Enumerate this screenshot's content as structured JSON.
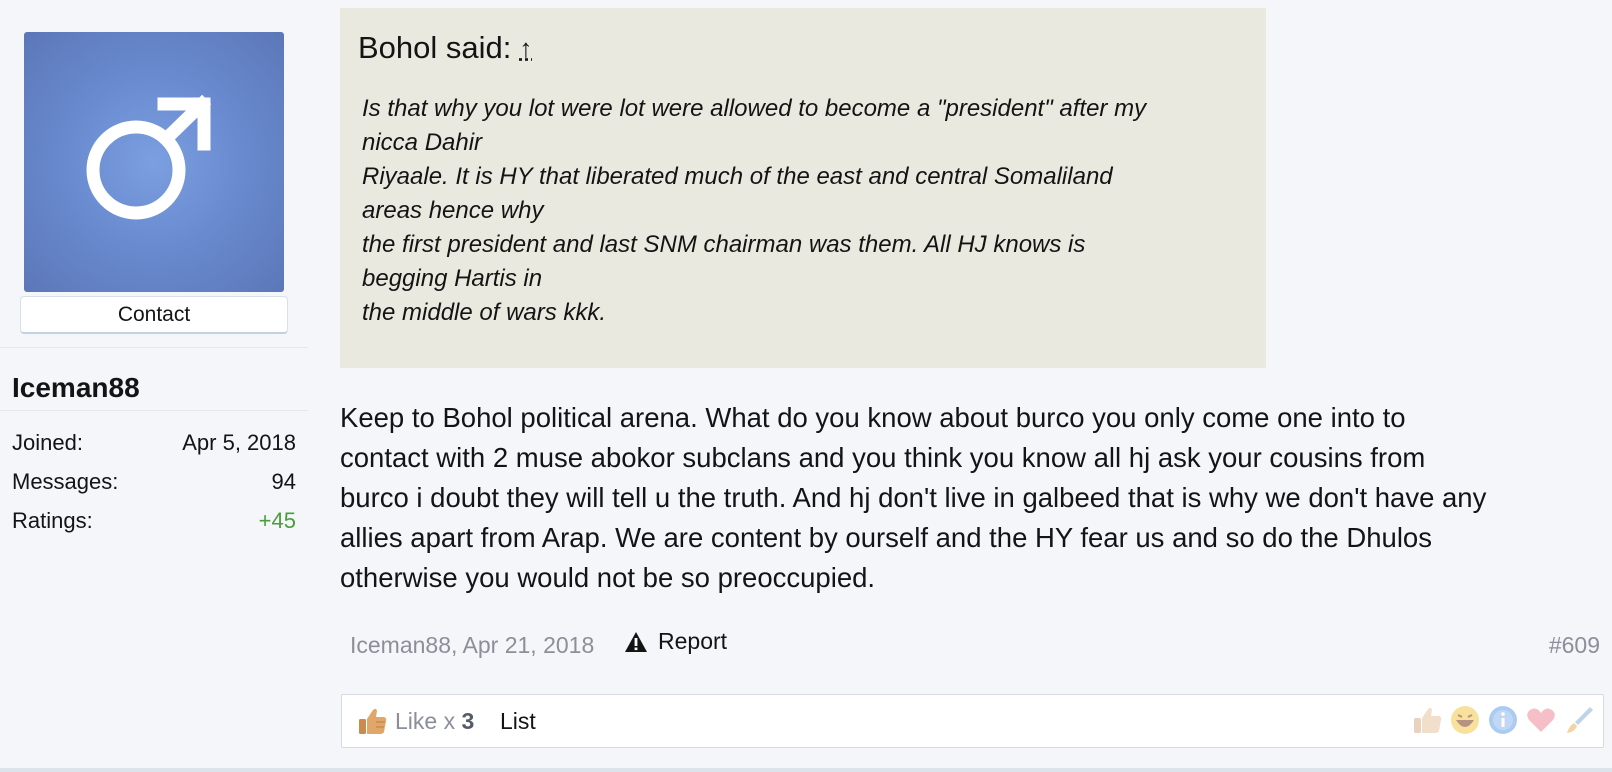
{
  "sidebar": {
    "contact_label": "Contact",
    "username": "Iceman88",
    "stats": [
      {
        "key": "Joined:",
        "value": "Apr 5, 2018"
      },
      {
        "key": "Messages:",
        "value": "94"
      },
      {
        "key": "Ratings:",
        "value": "+45"
      }
    ]
  },
  "quote": {
    "author_said": "Bohol said:",
    "jump_glyph": "↑",
    "lines": [
      "Is that why you lot were lot were allowed to become a \"president\" after my",
      "nicca Dahir",
      "Riyaale. It is HY that liberated much of the east and central Somaliland",
      "areas hence why",
      "the first president and last SNM chairman was them. All HJ knows is",
      "begging Hartis in",
      "the middle of wars kkk."
    ]
  },
  "message": {
    "lines": [
      "Keep to Bohol political arena. What do you know about burco you only come one into to",
      "contact with 2 muse abokor subclans and you think you know all hj ask your cousins from",
      "burco i doubt they will tell u the truth. And hj don't live in galbeed that is why we don't have any",
      "allies apart from Arap. We are content by ourself and the HY fear us and so do the Dhulos",
      "otherwise you would not be so preoccupied."
    ]
  },
  "footer": {
    "author_date": "Iceman88, Apr 21, 2018",
    "report_label": "Report",
    "post_number": "#609"
  },
  "likes": {
    "prefix": "Like x",
    "count": "3",
    "list_label": "List"
  },
  "icons": {
    "avatar": "male-symbol-icon",
    "report": "warning-triangle-icon",
    "like": "thumbs-up-icon",
    "ratings": [
      "thumbs-up-icon",
      "laughing-face-icon",
      "info-icon",
      "heart-icon",
      "brush-icon"
    ]
  },
  "colors": {
    "avatar_bg": "#6a8bd0",
    "quote_bg": "#eae9df",
    "ratings_positive": "#4a9e3a",
    "muted_text": "#8a8f99"
  }
}
